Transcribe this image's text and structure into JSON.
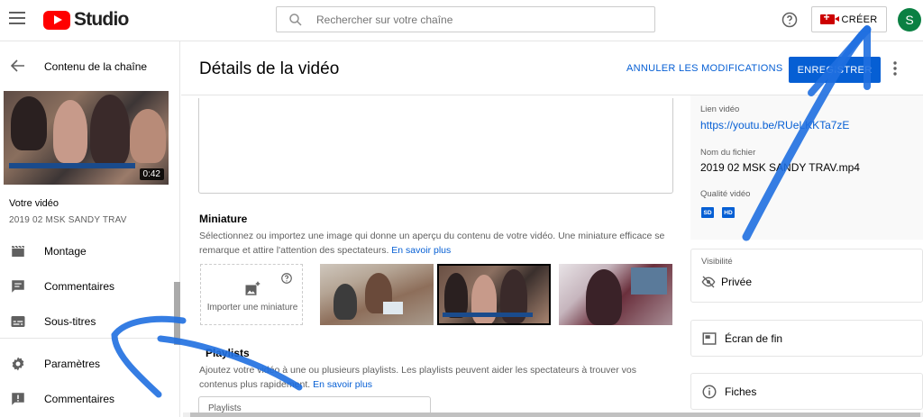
{
  "topbar": {
    "app_name": "Studio",
    "search_placeholder": "Rechercher sur votre chaîne",
    "create_label": "CRÉER",
    "avatar_letter": "S"
  },
  "sidebar": {
    "back_label": "Contenu de la chaîne",
    "thumbnail_duration": "0:42",
    "your_video_label": "Votre vidéo",
    "video_name": "2019 02 MSK SANDY TRAV",
    "items": [
      {
        "label": "Montage",
        "icon": "clapperboard-icon"
      },
      {
        "label": "Commentaires",
        "icon": "comment-icon"
      },
      {
        "label": "Sous-titres",
        "icon": "subtitles-icon"
      },
      {
        "label": "Paramètres",
        "icon": "gear-icon"
      },
      {
        "label": "Commentaires",
        "icon": "feedback-icon"
      }
    ]
  },
  "main": {
    "title": "Détails de la vidéo",
    "undo_label": "ANNULER LES MODIFICATIONS",
    "save_label": "ENREGISTRER",
    "thumbnail": {
      "title": "Miniature",
      "description": "Sélectionnez ou importez une image qui donne un aperçu du contenu de votre vidéo. Une miniature efficace se remarque et attire l'attention des spectateurs.",
      "learn_more": "En savoir plus",
      "upload_label": "Importer une miniature"
    },
    "playlists": {
      "title": "Playlists",
      "description": "Ajoutez votre vidéo à une ou plusieurs playlists. Les playlists peuvent aider les spectateurs à trouver vos contenus plus rapidement.",
      "learn_more": "En savoir plus",
      "select_placeholder": "Playlists"
    }
  },
  "details": {
    "video_link_label": "Lien vidéo",
    "video_link": "https://youtu.be/RUeLKKTa7zE",
    "filename_label": "Nom du fichier",
    "filename": "2019 02 MSK SANDY TRAV.mp4",
    "quality_label": "Qualité vidéo",
    "quality_badges": [
      "SD",
      "HD"
    ],
    "visibility_label": "Visibilité",
    "visibility_value": "Privée",
    "end_screen_label": "Écran de fin",
    "cards_label": "Fiches"
  },
  "colors": {
    "accent": "#065fd4",
    "brand_red": "#ff0000",
    "annotation_blue": "#1f6fe0",
    "avatar_green": "#0b8043"
  }
}
